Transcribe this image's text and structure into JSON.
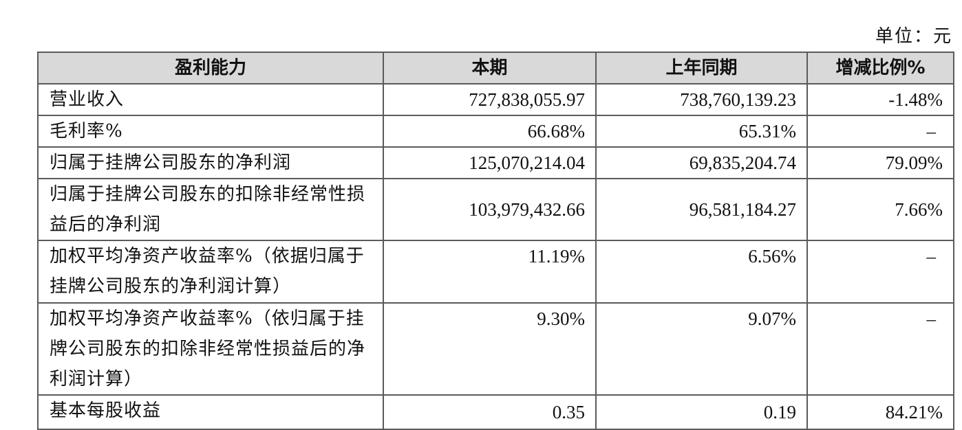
{
  "unit_label": "单位：元",
  "table": {
    "headers": [
      "盈利能力",
      "本期",
      "上年同期",
      "增减比例%"
    ],
    "rows": [
      {
        "label": "营业收入",
        "current": "727,838,055.97",
        "prior": "738,760,139.23",
        "change": "-1.48%"
      },
      {
        "label": "毛利率%",
        "current": "66.68%",
        "prior": "65.31%",
        "change": "–"
      },
      {
        "label": "归属于挂牌公司股东的净利润",
        "current": "125,070,214.04",
        "prior": "69,835,204.74",
        "change": "79.09%"
      },
      {
        "label": "归属于挂牌公司股东的扣除非经常性损益后的净利润",
        "current": "103,979,432.66",
        "prior": "96,581,184.27",
        "change": "7.66%"
      },
      {
        "label": "加权平均净资产收益率%（依据归属于挂牌公司股东的净利润计算）",
        "current": "11.19%",
        "prior": "6.56%",
        "change": "–"
      },
      {
        "label": "加权平均净资产收益率%（依归属于挂牌公司股东的扣除非经常性损益后的净利润计算）",
        "current": "9.30%",
        "prior": "9.07%",
        "change": "–"
      },
      {
        "label": "基本每股收益",
        "current": "0.35",
        "prior": "0.19",
        "change": "84.21%"
      }
    ]
  }
}
